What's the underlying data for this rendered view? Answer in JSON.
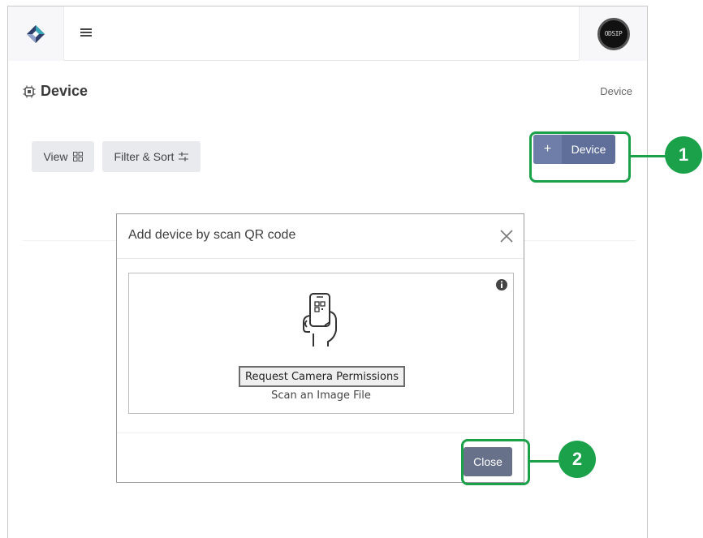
{
  "header": {
    "logo_icon": "diamond-logo-icon",
    "menu_icon": "hamburger-menu-icon",
    "avatar_text": "ODSIP"
  },
  "page": {
    "title_icon": "chip-icon",
    "title": "Device",
    "breadcrumb": "Device"
  },
  "toolbar": {
    "view_label": "View",
    "view_icon": "grid-icon",
    "filter_label": "Filter & Sort",
    "filter_icon": "sliders-icon",
    "add_device_plus": "+",
    "add_device_label": "Device"
  },
  "modal": {
    "title": "Add device by scan QR code",
    "close_icon": "close-x-icon",
    "info_icon": "info-icon",
    "phone_icon": "phone-qr-scan-icon",
    "camera_button": "Request Camera Permissions",
    "scan_file_link": "Scan an Image File",
    "close_button": "Close"
  },
  "annotations": {
    "callout_1": "1",
    "callout_2": "2",
    "highlight_color": "#1aa14a"
  },
  "colors": {
    "primary_button": "#5f6f99",
    "close_button": "#68718a",
    "light_button": "#e9eaee"
  }
}
